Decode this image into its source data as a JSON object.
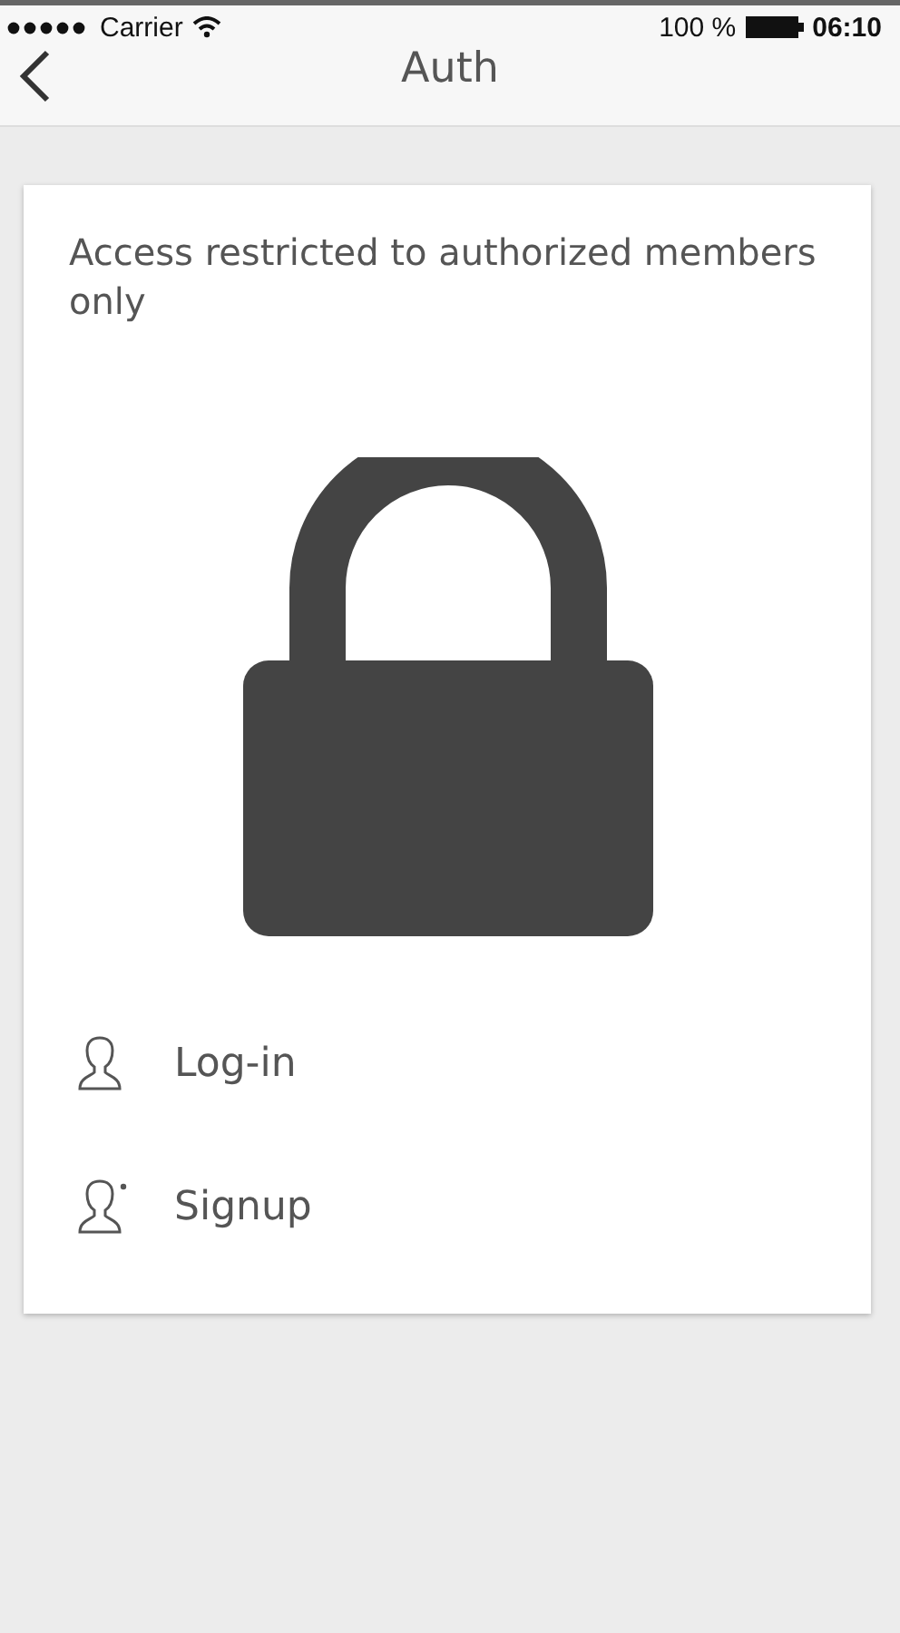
{
  "status_bar": {
    "carrier": "Carrier",
    "battery": "100 %",
    "time": "06:10"
  },
  "nav_bar": {
    "title": "Auth"
  },
  "card": {
    "message": "Access restricted to authorized members only",
    "actions": [
      {
        "kind": "login",
        "label": "Log-in"
      },
      {
        "kind": "signup",
        "label": "Signup"
      }
    ]
  }
}
